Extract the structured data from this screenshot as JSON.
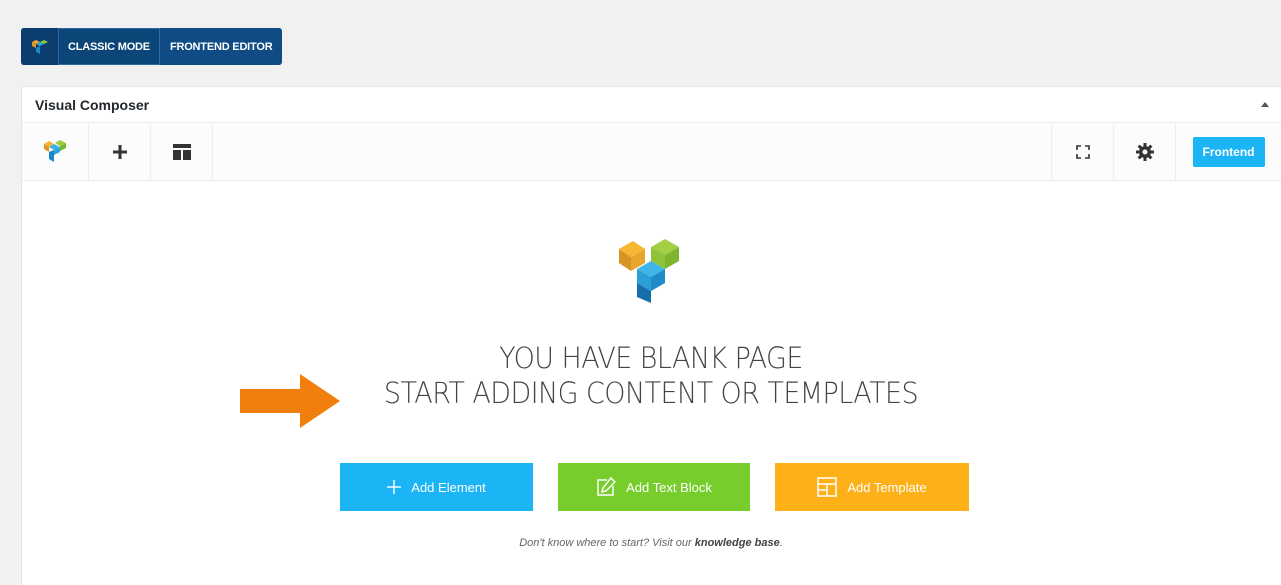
{
  "mode_switch": {
    "logo_icon": "vc-logo-icon",
    "classic_label": "CLASSIC MODE",
    "frontend_label": "FRONTEND EDITOR",
    "active": "CLASSIC MODE"
  },
  "panel": {
    "title": "Visual Composer",
    "toolbar": {
      "left_icons": [
        "vc-logo-icon",
        "plus-icon",
        "template-layout-icon"
      ],
      "right_icons": [
        "fullscreen-icon",
        "gear-icon"
      ],
      "frontend_button": "Frontend"
    }
  },
  "blank_page": {
    "headline_line1": "YOU HAVE BLANK PAGE",
    "headline_line2": "START ADDING CONTENT OR TEMPLATES",
    "buttons": [
      {
        "label": "Add Element",
        "icon": "plus-icon",
        "color": "#1bb5f5"
      },
      {
        "label": "Add Text Block",
        "icon": "edit-icon",
        "color": "#77cd2c"
      },
      {
        "label": "Add Template",
        "icon": "template-icon",
        "color": "#feb019"
      }
    ],
    "hint_prefix": "Don't know where to start? Visit our ",
    "hint_link": "knowledge base",
    "hint_suffix": "."
  },
  "colors": {
    "accent_blue": "#1bb5f5",
    "classic_mode_bar": "#0f4b84",
    "annotation_arrow": "#f07f0d"
  }
}
